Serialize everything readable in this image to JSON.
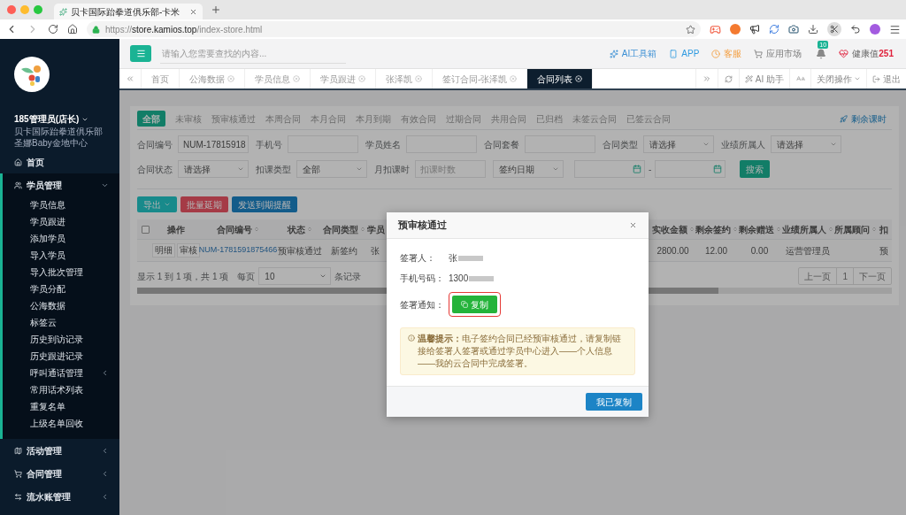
{
  "browser": {
    "tab_title": "贝卡国际跆拳道俱乐部-卡米",
    "url": {
      "scheme": "https://",
      "host": "store.kamios.top",
      "path": "/index-store.html"
    }
  },
  "sidebar": {
    "user": "185管理员(店长)",
    "org": "贝卡国际跆拳道俱乐部",
    "center": "圣娜Baby金地中心",
    "items": [
      {
        "label": "首页"
      },
      {
        "label": "学员管理",
        "expanded": true,
        "children": [
          {
            "label": "学员信息"
          },
          {
            "label": "学员跟进"
          },
          {
            "label": "添加学员"
          },
          {
            "label": "导入学员"
          },
          {
            "label": "导入批次管理"
          },
          {
            "label": "学员分配"
          },
          {
            "label": "公海数据"
          },
          {
            "label": "标签云"
          },
          {
            "label": "历史到访记录"
          },
          {
            "label": "历史跟进记录"
          },
          {
            "label": "呼叫通话管理",
            "expanded": false
          },
          {
            "label": "常用话术列表"
          },
          {
            "label": "重复名单"
          },
          {
            "label": "上级名单回收"
          }
        ]
      },
      {
        "label": "活动管理",
        "expanded": false
      },
      {
        "label": "合同管理",
        "expanded": false
      },
      {
        "label": "流水账管理",
        "expanded": false
      }
    ]
  },
  "header": {
    "search_placeholder": "请输入您需要查找的内容...",
    "tools": [
      {
        "kind": "ai",
        "label": "AI工具箱"
      },
      {
        "kind": "app",
        "label": "APP"
      },
      {
        "kind": "service",
        "label": "客服"
      },
      {
        "kind": "market",
        "label": "应用市场"
      }
    ],
    "notification_count": "10",
    "health": {
      "label": "健康值",
      "value": "251"
    }
  },
  "page_tabs": [
    {
      "label": "首页",
      "closable": false,
      "selected": false
    },
    {
      "label": "公海数据",
      "closable": true,
      "selected": false
    },
    {
      "label": "学员信息",
      "closable": true,
      "selected": false
    },
    {
      "label": "学员跟进",
      "closable": true,
      "selected": false
    },
    {
      "label": "张泽凯",
      "closable": true,
      "selected": false
    },
    {
      "label": "签订合同-张泽凯",
      "closable": true,
      "selected": false
    },
    {
      "label": "合同列表",
      "closable": true,
      "selected": true
    }
  ],
  "tab_actions": {
    "ai_assistant": "AI 助手",
    "close_ops": "关闭操作",
    "logout": "退出"
  },
  "filters": [
    {
      "label": "全部",
      "selected": true
    },
    {
      "label": "未审核",
      "selected": false
    },
    {
      "label": "预审核通过",
      "selected": false
    },
    {
      "label": "本周合同",
      "selected": false
    },
    {
      "label": "本月合同",
      "selected": false
    },
    {
      "label": "本月到期",
      "selected": false
    },
    {
      "label": "有效合同",
      "selected": false
    },
    {
      "label": "过期合同",
      "selected": false
    },
    {
      "label": "共用合同",
      "selected": false
    },
    {
      "label": "已归档",
      "selected": false
    },
    {
      "label": "未签云合同",
      "selected": false
    },
    {
      "label": "已签云合同",
      "selected": false
    }
  ],
  "remaining_hours_link": "剩余课时",
  "form": {
    "rows": [
      [
        {
          "kind": "text",
          "label": "合同编号",
          "value": "NUM-17815918"
        },
        {
          "kind": "text",
          "label": "手机号"
        },
        {
          "kind": "text",
          "label": "学员姓名"
        },
        {
          "kind": "text",
          "label": "合同套餐"
        },
        {
          "kind": "select",
          "label": "合同类型",
          "value": "请选择"
        },
        {
          "kind": "select",
          "label": "业绩所属人",
          "value": "请选择"
        }
      ],
      [
        {
          "kind": "select",
          "label": "合同状态",
          "value": "请选择"
        },
        {
          "kind": "select",
          "label": "扣课类型",
          "value": "全部"
        },
        {
          "kind": "text",
          "label": "月扣课时",
          "placeholder": "扣课时数"
        },
        {
          "kind": "select",
          "value": "签约日期"
        },
        {
          "kind": "daterange",
          "separator": "-"
        },
        {
          "kind": "button",
          "label": "搜索"
        }
      ]
    ]
  },
  "toolbar": [
    {
      "kind": "dropdown",
      "label": "导出"
    },
    {
      "kind": "danger",
      "label": "批量延期"
    },
    {
      "kind": "primary",
      "label": "发送到期提醒"
    }
  ],
  "table": {
    "select_all_checked": false,
    "columns": [
      {
        "label": "操作",
        "sortable": false
      },
      {
        "label": "合同编号",
        "sortable": true,
        "kind": "link"
      },
      {
        "label": "状态",
        "sortable": true
      },
      {
        "label": "合同类型",
        "sortable": true
      },
      {
        "label": "学员"
      },
      {
        "label": "实收金额",
        "sortable": true
      },
      {
        "label": "剩余签约",
        "sortable": true
      },
      {
        "label": "剩余赠送",
        "sortable": true
      },
      {
        "label": "业绩所属人",
        "sortable": true
      },
      {
        "label": "所属顾问",
        "sortable": true
      },
      {
        "label": "扣"
      }
    ],
    "rows": [
      {
        "cells": [
          [
            "明细",
            "审核"
          ],
          "NUM-1781591875466",
          "预审核通过",
          "新签约",
          "张",
          "2800.00",
          "12.00",
          "0.00",
          "运营管理员",
          null,
          "预"
        ]
      }
    ]
  },
  "footer": {
    "summary": "显示 1 到 1 项，共 1 项",
    "per_page_label": "每页",
    "per_page": "10",
    "records_label": "条记录",
    "pages": [
      "上一页",
      "1",
      "下一页"
    ]
  },
  "modal": {
    "title": "预审核通过",
    "fields": [
      {
        "kind": "text",
        "label": "签署人：",
        "value": "张",
        "redacted": true
      },
      {
        "kind": "text",
        "label": "手机号码：",
        "value": "1300",
        "redacted": true
      },
      {
        "kind": "button",
        "label": "签署通知：",
        "button": "复制",
        "highlighted": true
      }
    ],
    "notice": "**温馨提示：**电子签约合同已经预审核通过，请复制链接给签署人签署或通过学员中心进入——个人信息——我的云合同中完成签署。",
    "confirm": "我已复制"
  }
}
